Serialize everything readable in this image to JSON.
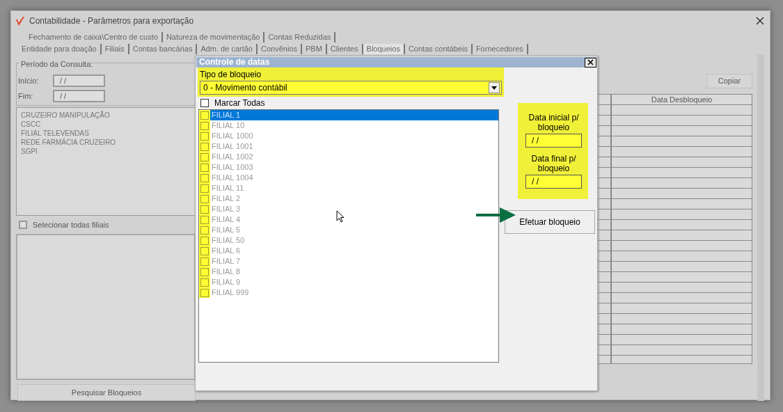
{
  "window": {
    "title": "Contabilidade - Parâmetros para exportação"
  },
  "tab_rows": [
    [
      {
        "label": "Fechamento de caixa\\Centro de custo",
        "selected": false
      },
      {
        "label": "Natureza de movimentação",
        "selected": false
      },
      {
        "label": "Contas Reduzidas",
        "selected": false
      }
    ],
    [
      {
        "label": "Entidade para doação",
        "selected": false
      },
      {
        "label": "Filiais",
        "selected": false
      },
      {
        "label": "Contas bancárias",
        "selected": false
      },
      {
        "label": "Adm. de cartão",
        "selected": false
      },
      {
        "label": "Convênios",
        "selected": false
      },
      {
        "label": "PBM",
        "selected": false
      },
      {
        "label": "Clientes",
        "selected": false
      },
      {
        "label": "Bloqueios",
        "selected": true
      },
      {
        "label": "Contas contábeis",
        "selected": false
      },
      {
        "label": "Fornecedores",
        "selected": false
      }
    ]
  ],
  "period": {
    "legend": "Período da Consulta:",
    "start_label": "Início:",
    "start_value": "/ /",
    "end_label": "Fim:",
    "end_value": "/ /"
  },
  "branch_list": [
    "CRUZEIRO MANIPULAÇÃO",
    "CSCC",
    "FILIAL TELEVENDAS",
    "REDE FARMÁCIA CRUZEIRO",
    "SGPI"
  ],
  "select_all_branches": {
    "label": "Selecionar todas filiais",
    "checked": false
  },
  "search_button": "Pesquisar Bloqueios",
  "copy_button": "Copiar",
  "grid": {
    "columns": [
      "Data Desbloqueio"
    ]
  },
  "dialog": {
    "title": "Controle de datas",
    "block_type": {
      "label": "Tipo de bloqueio",
      "value": "0 - Movimento contábil"
    },
    "mark_all": {
      "label": "Marcar Todas",
      "checked": false
    },
    "branches": [
      {
        "label": "FILIAL 1",
        "checked": false,
        "selected": true
      },
      {
        "label": "FILIAL 10",
        "checked": false,
        "selected": false
      },
      {
        "label": "FILIAL 1000",
        "checked": false,
        "selected": false
      },
      {
        "label": "FILIAL 1001",
        "checked": false,
        "selected": false
      },
      {
        "label": "FILIAL 1002",
        "checked": false,
        "selected": false
      },
      {
        "label": "FILIAL 1003",
        "checked": false,
        "selected": false
      },
      {
        "label": "FILIAL 1004",
        "checked": false,
        "selected": false
      },
      {
        "label": "FILIAL 11",
        "checked": false,
        "selected": false
      },
      {
        "label": "FILIAL 2",
        "checked": false,
        "selected": false
      },
      {
        "label": "FILIAL 3",
        "checked": false,
        "selected": false
      },
      {
        "label": "FILIAL 4",
        "checked": false,
        "selected": false
      },
      {
        "label": "FILIAL 5",
        "checked": false,
        "selected": false
      },
      {
        "label": "FILIAL 50",
        "checked": false,
        "selected": false
      },
      {
        "label": "FILIAL 6",
        "checked": false,
        "selected": false
      },
      {
        "label": "FILIAL 7",
        "checked": false,
        "selected": false
      },
      {
        "label": "FILIAL 8",
        "checked": false,
        "selected": false
      },
      {
        "label": "FILIAL 9",
        "checked": false,
        "selected": false
      },
      {
        "label": "FILIAL 999",
        "checked": false,
        "selected": false
      }
    ],
    "start_date": {
      "label": "Data inicial p/ bloqueio",
      "value": "/ /"
    },
    "end_date": {
      "label": "Data final p/ bloqueio",
      "value": "/ /"
    },
    "apply_button": "Efetuar bloqueio"
  }
}
